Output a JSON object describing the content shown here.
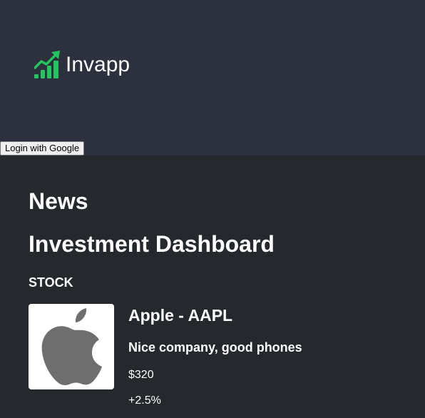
{
  "header": {
    "brand_name": "Invapp",
    "brand_icon": "chart-growth-icon",
    "login_label": "Login with Google"
  },
  "main": {
    "news_title": "News",
    "dashboard_title": "Investment Dashboard",
    "section_label": "STOCK",
    "stocks": [
      {
        "logo_icon": "apple-logo-icon",
        "name": "Apple - AAPL",
        "description": "Nice company, good phones",
        "price": "$320",
        "change": "+2.5%"
      }
    ]
  },
  "colors": {
    "header_bg": "#2c313d",
    "page_bg": "#25282c",
    "brand_green": "#22c55e",
    "logo_grey": "#6e6e6e"
  }
}
